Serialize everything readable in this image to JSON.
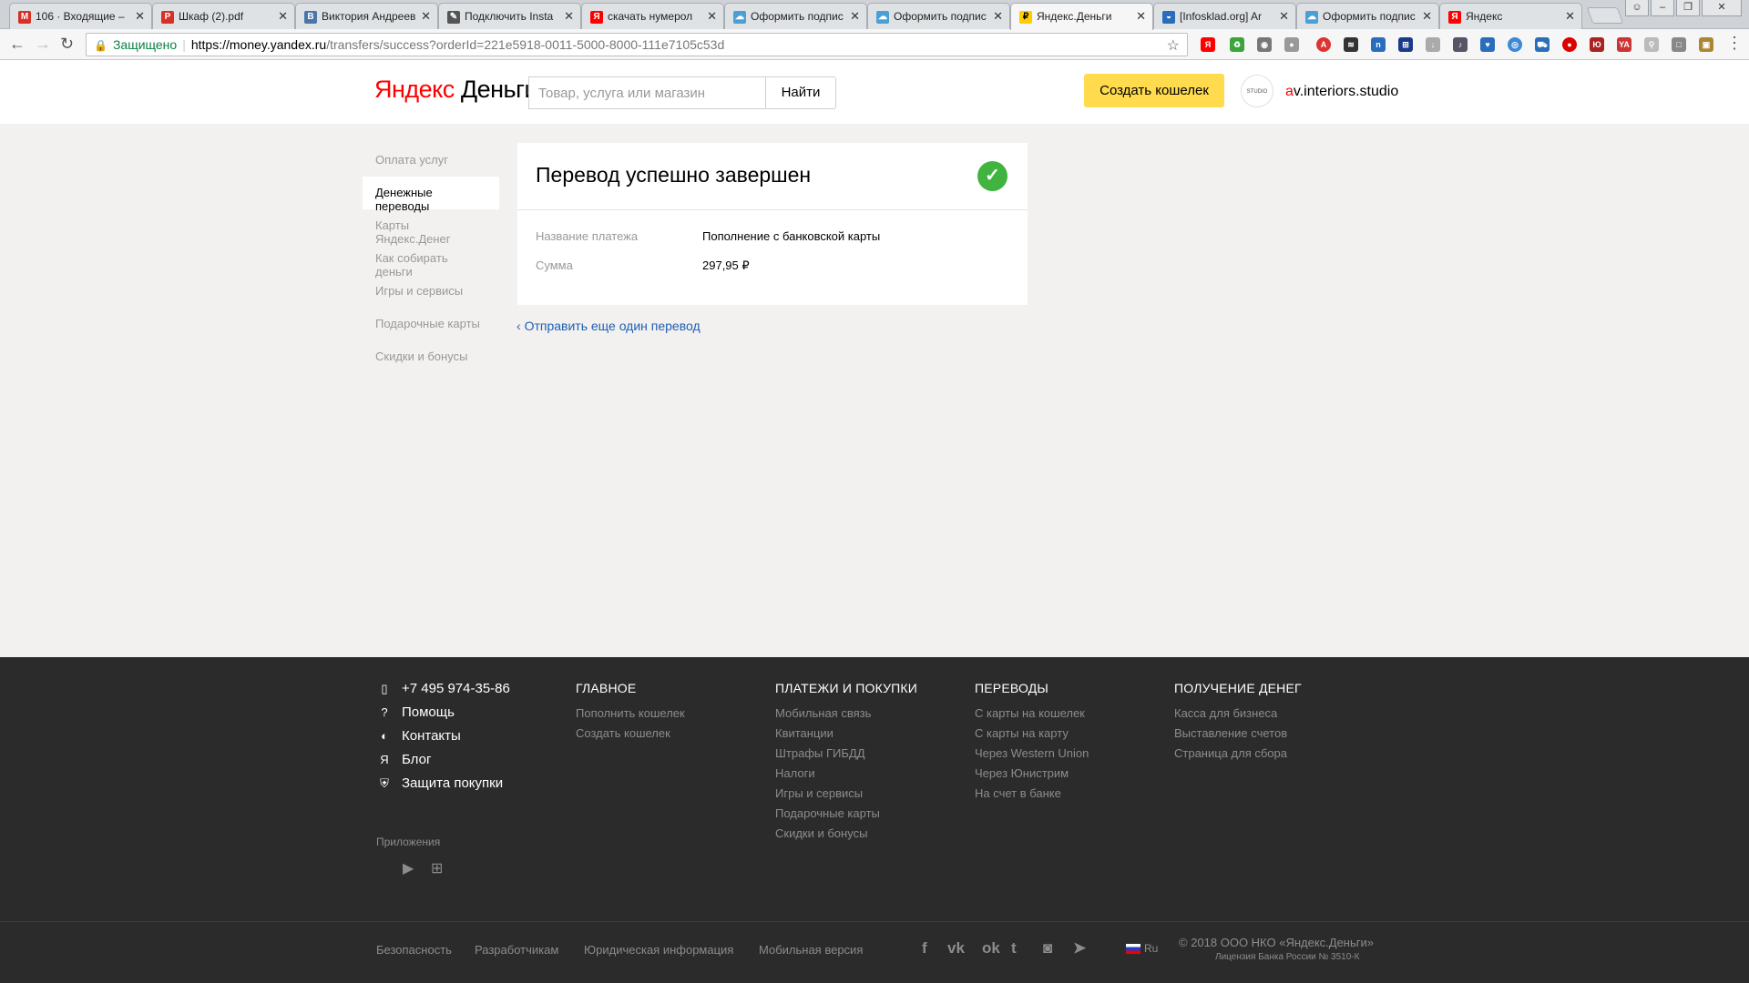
{
  "browser": {
    "tabs": [
      {
        "label": "106 · Входящие –",
        "favicon": "gmail-icon",
        "color": "#d93025"
      },
      {
        "label": "Шкаф (2).pdf",
        "favicon": "pdf-icon",
        "color": "#d93025"
      },
      {
        "label": "Виктория Андреев",
        "favicon": "vk-icon",
        "color": "#4a76a8"
      },
      {
        "label": "Подключить Insta",
        "favicon": "edit-icon",
        "color": "#555555"
      },
      {
        "label": "скачать нумерол",
        "favicon": "yandex-icon",
        "color": "#ff0000"
      },
      {
        "label": "Оформить подпис",
        "favicon": "cloud-icon",
        "color": "#4a9fd5"
      },
      {
        "label": "Оформить подпис",
        "favicon": "cloud-icon",
        "color": "#4a9fd5"
      },
      {
        "label": "Яндекс.Деньги",
        "favicon": "yandex-money-icon",
        "color": "#ffcc00"
      },
      {
        "label": "[Infosklad.org] Ar",
        "favicon": "infosklad-icon",
        "color": "#2a6ebb"
      },
      {
        "label": "Оформить подпис",
        "favicon": "cloud-icon",
        "color": "#4a9fd5"
      },
      {
        "label": "Яндекс",
        "favicon": "yandex-icon",
        "color": "#ff0000"
      }
    ],
    "active_tab": 7,
    "security_label": "Защищено",
    "url_scheme_host": "https://money.yandex.ru",
    "url_path": "/transfers/success?orderId=221e5918-0011-5000-8000-111e7105c53d"
  },
  "header": {
    "logo_brand": "Яндекс",
    "logo_product": "Деньги",
    "search_placeholder": "Товар, услуга или магазин",
    "search_button": "Найти",
    "create_wallet_button": "Создать кошелек",
    "avatar_text": "STUDIO",
    "username_first": "a",
    "username_rest": "v.interiors.studio"
  },
  "sidebar": {
    "items": [
      {
        "label": "Оплата услуг",
        "active": false
      },
      {
        "label": "Денежные переводы",
        "active": true
      },
      {
        "label": "Карты Яндекс.Денег",
        "active": false
      },
      {
        "label": "Как собирать деньги",
        "active": false
      },
      {
        "label": "Игры и сервисы",
        "active": false
      },
      {
        "label": "Подарочные карты",
        "active": false
      },
      {
        "label": "Скидки и бонусы",
        "active": false
      }
    ]
  },
  "result": {
    "title": "Перевод успешно завершен",
    "status_icon": "check-icon",
    "payment_name_label": "Название платежа",
    "payment_name_value": "Пополнение с банковской карты",
    "amount_label": "Сумма",
    "amount_value": "297,95 ₽",
    "back_link": "Отправить еще один перевод"
  },
  "footer": {
    "contacts": [
      {
        "label": "+7 495 974-35-86",
        "icon": "phone-icon"
      },
      {
        "label": "Помощь",
        "icon": "help-icon"
      },
      {
        "label": "Контакты",
        "icon": "contacts-icon"
      },
      {
        "label": "Блог",
        "icon": "blog-icon"
      },
      {
        "label": "Защита покупки",
        "icon": "shield-icon"
      }
    ],
    "columns": [
      {
        "title": "Главное",
        "links": [
          "Пополнить кошелек",
          "Создать кошелек"
        ]
      },
      {
        "title": "Платежи и покупки",
        "links": [
          "Мобильная связь",
          "Квитанции",
          "Штрафы ГИБДД",
          "Налоги",
          "Игры и сервисы",
          "Подарочные карты",
          "Скидки и бонусы"
        ]
      },
      {
        "title": "Переводы",
        "links": [
          "С карты на кошелек",
          "С карты на карту",
          "Через Western Union",
          "Через Юнистрим",
          "На счет в банке"
        ]
      },
      {
        "title": "Получение денег",
        "links": [
          "Касса для бизнеса",
          "Выставление счетов",
          "Страница для сбора"
        ]
      }
    ],
    "apps_label": "Приложения",
    "apps": [
      "apple-icon",
      "google-play-icon",
      "windows-icon"
    ],
    "bottom_links": [
      "Безопасность",
      "Разработчикам",
      "Юридическая информация",
      "Мобильная версия"
    ],
    "social": [
      "facebook-icon",
      "vk-icon",
      "odnoklassniki-icon",
      "twitter-icon",
      "instagram-icon",
      "telegram-icon"
    ],
    "language": "Ru",
    "copyright": "© 2018 ООО НКО «Яндекс.Деньги»",
    "license": "Лицензия Банка России № 3510-К"
  },
  "colors": {
    "accent_yellow": "#ffdb4d",
    "success_green": "#40b43e",
    "link_blue": "#1e5fb4",
    "footer_bg": "#2b2b2b"
  }
}
